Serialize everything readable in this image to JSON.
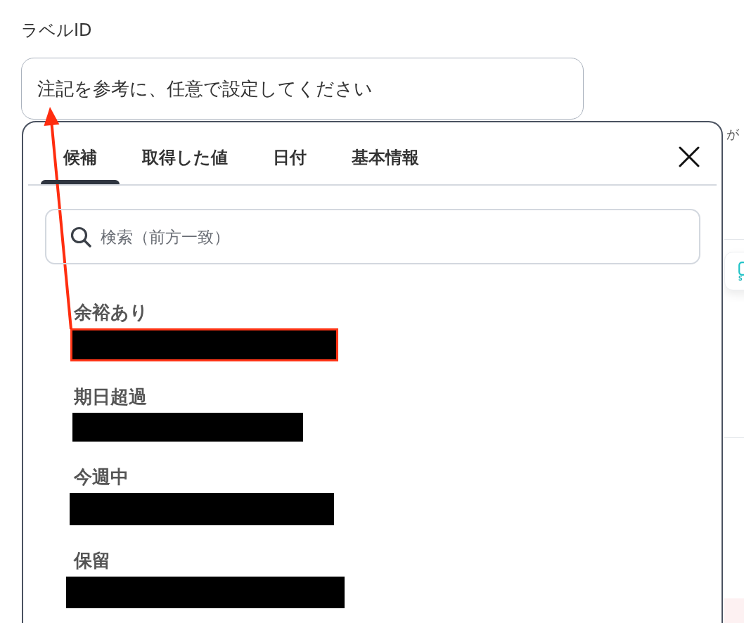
{
  "field": {
    "label": "ラベルID",
    "value": "注記を参考に、任意で設定してください"
  },
  "picker": {
    "tabs": [
      {
        "label": "候補",
        "selected": true
      },
      {
        "label": "取得した値",
        "selected": false
      },
      {
        "label": "日付",
        "selected": false
      },
      {
        "label": "基本情報",
        "selected": false
      }
    ],
    "search": {
      "placeholder": "検索（前方一致）"
    },
    "options": [
      {
        "label": "余裕あり",
        "redacted": true,
        "highlighted": true
      },
      {
        "label": "期日超過",
        "redacted": true,
        "highlighted": false
      },
      {
        "label": "今週中",
        "redacted": true,
        "highlighted": false
      },
      {
        "label": "保留",
        "redacted": true,
        "highlighted": false
      }
    ]
  },
  "background": {
    "side_text": "が",
    "card_text": "S"
  }
}
